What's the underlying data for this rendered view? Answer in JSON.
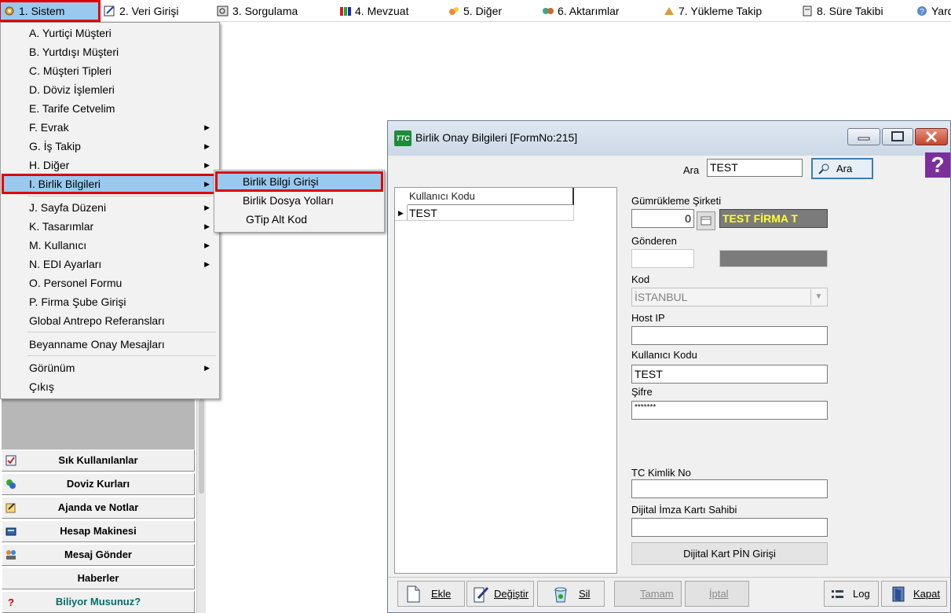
{
  "menubar": {
    "items": [
      {
        "label": "1.  Sistem",
        "icon": "system-icon"
      },
      {
        "label": "2.  Veri Girişi",
        "icon": "edit-icon"
      },
      {
        "label": "3.  Sorgulama",
        "icon": "query-icon"
      },
      {
        "label": "4.  Mevzuat",
        "icon": "books-icon"
      },
      {
        "label": "5.  Diğer",
        "icon": "other-icon"
      },
      {
        "label": "6.  Aktarımlar",
        "icon": "transfer-icon"
      },
      {
        "label": "7.  Yükleme Takip",
        "icon": "upload-icon"
      },
      {
        "label": "8. Süre Takibi",
        "icon": "timer-icon"
      },
      {
        "label": "Yard",
        "icon": "help-icon"
      }
    ]
  },
  "sistem_menu": {
    "items": [
      {
        "label": "A.  Yurtiçi Müşteri"
      },
      {
        "label": "B.  Yurtdışı Müşteri"
      },
      {
        "label": "C.  Müşteri Tipleri"
      },
      {
        "label": "D.  Döviz İşlemleri"
      },
      {
        "label": "E.  Tarife Cetvelim"
      },
      {
        "label": "F.  Evrak"
      },
      {
        "label": "G.  İş Takip"
      },
      {
        "label": "H.  Diğer"
      },
      {
        "label": "I.  Birlik Bilgileri"
      },
      {
        "label": "J.  Sayfa Düzeni"
      },
      {
        "label": "K.  Tasarımlar"
      },
      {
        "label": "M.  Kullanıcı"
      },
      {
        "label": "N.  EDI Ayarları"
      },
      {
        "label": "O.  Personel Formu"
      },
      {
        "label": "P.  Firma Şube Girişi"
      },
      {
        "label": "Global Antrepo Referansları"
      },
      {
        "label": "Beyanname Onay Mesajları"
      },
      {
        "label": "Görünüm"
      },
      {
        "label": "Çıkış"
      }
    ]
  },
  "birlik_submenu": {
    "items": [
      {
        "label": "Birlik Bilgi Girişi"
      },
      {
        "label": "Birlik Dosya Yolları"
      },
      {
        "label": "GTip Alt Kod"
      }
    ]
  },
  "left_panel": {
    "buttons": [
      {
        "label": "Sık Kullanılanlar",
        "icon": "favorites-icon"
      },
      {
        "label": "Doviz Kurları",
        "icon": "currency-icon"
      },
      {
        "label": "Ajanda ve Notlar",
        "icon": "notes-icon"
      },
      {
        "label": "Hesap Makinesi",
        "icon": "calculator-icon"
      },
      {
        "label": "Mesaj Gönder",
        "icon": "users-icon"
      },
      {
        "label": "Haberler",
        "icon": ""
      },
      {
        "label": "Biliyor Musunuz?",
        "icon": "question-icon"
      }
    ]
  },
  "window": {
    "title": "Birlik Onay Bilgileri [FormNo:215]",
    "icon_text": "TTC",
    "search": {
      "label": "Ara",
      "value": "TEST",
      "button": "Ara"
    },
    "help_glyph": "?",
    "grid": {
      "column": "Kullanıcı Kodu",
      "rows": [
        "TEST"
      ]
    },
    "form": {
      "gumrukleme_label": "Gümrükleme Şirketi",
      "gumrukleme_code": "0",
      "gumrukleme_name": "TEST FİRMA T",
      "gonderen_label": "Gönderen",
      "gonderen_value": "",
      "kod_label": "Kod",
      "kod_value": "İSTANBUL",
      "host_ip_label": "Host IP",
      "host_ip_value": "",
      "kullanici_label": "Kullanıcı Kodu",
      "kullanici_value": "TEST",
      "sifre_label": "Şifre",
      "sifre_value": "*******",
      "tc_label": "TC Kimlik No",
      "tc_value": "",
      "imza_label": "Dijital İmza Kartı Sahibi",
      "imza_value": "",
      "pin_button": "Dijital Kart PİN Girişi"
    },
    "buttons": {
      "ekle": "Ekle",
      "degistir": "Değiştir",
      "sil": "Sil",
      "tamam": "Tamam",
      "iptal": "İptal",
      "log": "Log",
      "kapat": "Kapat"
    }
  },
  "colors": {
    "menu_highlight": "#99c9ef",
    "red_outline": "#e00000",
    "firm_text": "#ffff33"
  }
}
